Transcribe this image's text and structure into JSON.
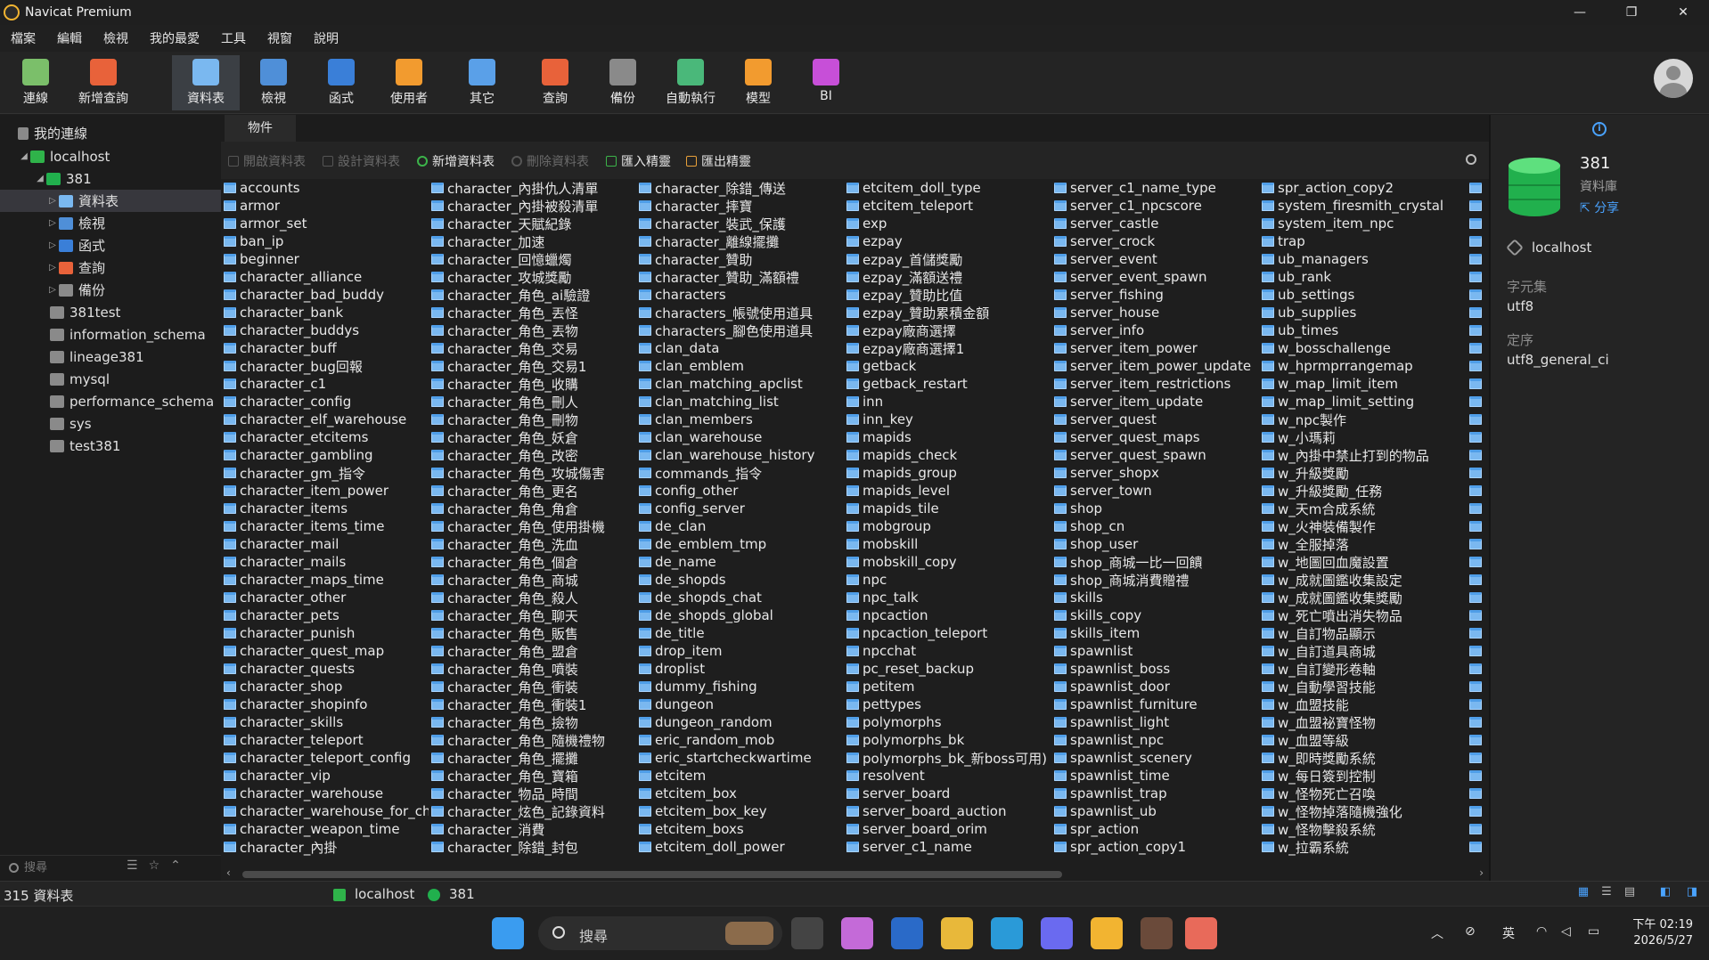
{
  "window": {
    "title": "Navicat Premium",
    "controls": [
      "—",
      "❐",
      "✕"
    ]
  },
  "menu": [
    "檔案",
    "編輯",
    "檢視",
    "我的最愛",
    "工具",
    "視窗",
    "說明"
  ],
  "toolbar": [
    {
      "label": "連線",
      "color": "#7bbf6a"
    },
    {
      "label": "新增查詢",
      "color": "#e8623a"
    },
    {
      "label": "資料表",
      "color": "#7ab8f0"
    },
    {
      "label": "檢視",
      "color": "#4f8fd8"
    },
    {
      "label": "函式",
      "color": "#3a7fd8"
    },
    {
      "label": "使用者",
      "color": "#f29b2f"
    },
    {
      "label": "其它",
      "color": "#5aa0e8"
    },
    {
      "label": "查詢",
      "color": "#e8623a"
    },
    {
      "label": "備份",
      "color": "#8a8a8a"
    },
    {
      "label": "自動執行",
      "color": "#4ab87a"
    },
    {
      "label": "模型",
      "color": "#f29b2f"
    },
    {
      "label": "BI",
      "color": "#c74fd8"
    }
  ],
  "sidebar": {
    "header": "我的連線",
    "connection": "localhost",
    "database": "381",
    "db_children": [
      "資料表",
      "檢視",
      "函式",
      "查詢",
      "備份"
    ],
    "other_dbs": [
      "381test",
      "information_schema",
      "lineage381",
      "mysql",
      "performance_schema",
      "sys",
      "test381"
    ],
    "search_placeholder": "搜尋"
  },
  "tab_label": "物件",
  "objtoolbar": {
    "open": "開啟資料表",
    "design": "設計資料表",
    "new": "新增資料表",
    "delete": "刪除資料表",
    "import": "匯入精靈",
    "export": "匯出精靈"
  },
  "tables": [
    [
      "accounts",
      "armor",
      "armor_set",
      "ban_ip",
      "beginner",
      "character_alliance",
      "character_bad_buddy",
      "character_bank",
      "character_buddys",
      "character_buff",
      "character_bug回報",
      "character_c1",
      "character_config",
      "character_elf_warehouse",
      "character_etcitems",
      "character_gambling",
      "character_gm_指令",
      "character_item_power",
      "character_items",
      "character_items_time",
      "character_mail",
      "character_mails",
      "character_maps_time",
      "character_other",
      "character_pets",
      "character_punish",
      "character_quest_map",
      "character_quests",
      "character_shop",
      "character_shopinfo",
      "character_skills",
      "character_teleport",
      "character_teleport_config",
      "character_vip",
      "character_warehouse",
      "character_warehouse_for_cha",
      "character_weapon_time",
      "character_內掛"
    ],
    [
      "character_內掛仇人清單",
      "character_內掛被殺清單",
      "character_天賦紀錄",
      "character_加速",
      "character_回憶蠟燭",
      "character_攻城獎勵",
      "character_角色_ai驗證",
      "character_角色_丟怪",
      "character_角色_丟物",
      "character_角色_交易",
      "character_角色_交易1",
      "character_角色_收購",
      "character_角色_刪人",
      "character_角色_刪物",
      "character_角色_妖倉",
      "character_角色_改密",
      "character_角色_攻城傷害",
      "character_角色_更名",
      "character_角色_角倉",
      "character_角色_使用掛機",
      "character_角色_洗血",
      "character_角色_個倉",
      "character_角色_商城",
      "character_角色_殺人",
      "character_角色_聊天",
      "character_角色_販售",
      "character_角色_盟倉",
      "character_角色_噴裝",
      "character_角色_衝裝",
      "character_角色_衝裝1",
      "character_角色_撿物",
      "character_角色_隨機禮物",
      "character_角色_擺攤",
      "character_角色_寶箱",
      "character_物品_時間",
      "character_炫色_記錄資料",
      "character_消費",
      "character_除錯_封包"
    ],
    [
      "character_除錯_傳送",
      "character_摔寶",
      "character_裝武_保護",
      "character_離線擺攤",
      "character_贊助",
      "character_贊助_滿額禮",
      "characters",
      "characters_帳號使用道具",
      "characters_腳色使用道具",
      "clan_data",
      "clan_emblem",
      "clan_matching_apclist",
      "clan_matching_list",
      "clan_members",
      "clan_warehouse",
      "clan_warehouse_history",
      "commands_指令",
      "config_other",
      "config_server",
      "de_clan",
      "de_emblem_tmp",
      "de_name",
      "de_shopds",
      "de_shopds_chat",
      "de_shopds_global",
      "de_title",
      "drop_item",
      "droplist",
      "dummy_fishing",
      "dungeon",
      "dungeon_random",
      "eric_random_mob",
      "eric_startcheckwartime",
      "etcitem",
      "etcitem_box",
      "etcitem_box_key",
      "etcitem_boxs",
      "etcitem_doll_power"
    ],
    [
      "etcitem_doll_type",
      "etcitem_teleport",
      "exp",
      "ezpay",
      "ezpay_首儲獎勵",
      "ezpay_滿額送禮",
      "ezpay_贊助比值",
      "ezpay_贊助累積金額",
      "ezpay廠商選擇",
      "ezpay廠商選擇1",
      "getback",
      "getback_restart",
      "inn",
      "inn_key",
      "mapids",
      "mapids_check",
      "mapids_group",
      "mapids_level",
      "mapids_tile",
      "mobgroup",
      "mobskill",
      "mobskill_copy",
      "npc",
      "npc_talk",
      "npcaction",
      "npcaction_teleport",
      "npcchat",
      "pc_reset_backup",
      "petitem",
      "pettypes",
      "polymorphs",
      "polymorphs_bk",
      "polymorphs_bk_新boss可用)",
      "resolvent",
      "server_board",
      "server_board_auction",
      "server_board_orim",
      "server_c1_name"
    ],
    [
      "server_c1_name_type",
      "server_c1_npcscore",
      "server_castle",
      "server_crock",
      "server_event",
      "server_event_spawn",
      "server_fishing",
      "server_house",
      "server_info",
      "server_item_power",
      "server_item_power_update",
      "server_item_restrictions",
      "server_item_update",
      "server_quest",
      "server_quest_maps",
      "server_quest_spawn",
      "server_shopx",
      "server_town",
      "shop",
      "shop_cn",
      "shop_user",
      "shop_商城一比一回饋",
      "shop_商城消費贈禮",
      "skills",
      "skills_copy",
      "skills_item",
      "spawnlist",
      "spawnlist_boss",
      "spawnlist_door",
      "spawnlist_furniture",
      "spawnlist_light",
      "spawnlist_npc",
      "spawnlist_scenery",
      "spawnlist_time",
      "spawnlist_trap",
      "spawnlist_ub",
      "spr_action",
      "spr_action_copy1"
    ],
    [
      "spr_action_copy2",
      "system_firesmith_crystal",
      "system_item_npc",
      "trap",
      "ub_managers",
      "ub_rank",
      "ub_settings",
      "ub_supplies",
      "ub_times",
      "w_bosschallenge",
      "w_hprmprrangemap",
      "w_map_limit_item",
      "w_map_limit_setting",
      "w_npc製作",
      "w_小瑪莉",
      "w_內掛中禁止打到的物品",
      "w_升級獎勵",
      "w_升級獎勵_任務",
      "w_天m合成系統",
      "w_火神裝備製作",
      "w_全服掉落",
      "w_地圖回血魔設置",
      "w_成就圖鑑收集設定",
      "w_成就圖鑑收集獎勵",
      "w_死亡噴出消失物品",
      "w_自訂物品顯示",
      "w_自訂道具商城",
      "w_自訂變形卷軸",
      "w_自動學習技能",
      "w_血盟技能",
      "w_血盟祕寶怪物",
      "w_血盟等級",
      "w_即時獎勵系統",
      "w_每日簽到控制",
      "w_怪物死亡召喚",
      "w_怪物掉落隨機強化",
      "w_怪物擊殺系統",
      "w_拉霸系統"
    ]
  ],
  "info": {
    "name": "381",
    "type": "資料庫",
    "share": "分享",
    "host": "localhost",
    "charset_label": "字元集",
    "charset": "utf8",
    "collation_label": "定序",
    "collation": "utf8_general_ci"
  },
  "status": {
    "count": "315 資料表",
    "connection": "localhost",
    "database": "381"
  },
  "taskbar": {
    "search": "搜尋",
    "ime": "英",
    "time": "下午 02:19",
    "date": "2026/5/27"
  }
}
